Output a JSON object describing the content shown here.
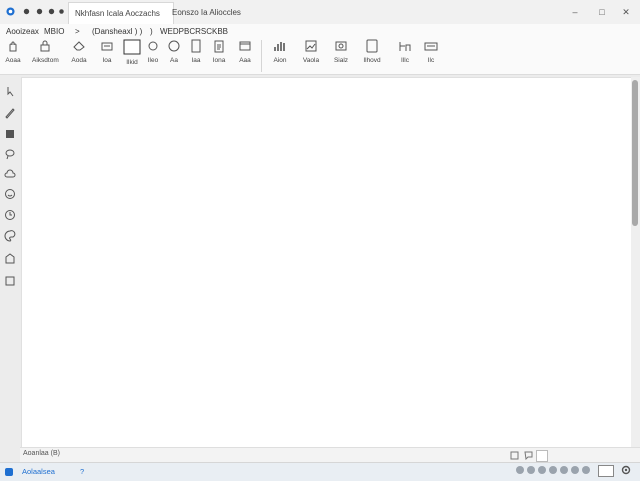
{
  "titlebar": {
    "tabs": [
      "Nkhfasn Icala Aoczachs",
      "Eonszo Ia Alioccles"
    ],
    "controls": {
      "minimize": "–",
      "maximize": "□",
      "close": "✕"
    }
  },
  "ribbon": {
    "breadcrumb": [
      "Aooizeax",
      "MBIO",
      ">",
      "(Dansheaxl ) )",
      ")",
      "WEDPBCRSCKBB"
    ],
    "tools_left": [
      {
        "icon": "hand-icon",
        "label": "Aoaa"
      },
      {
        "icon": "lock-icon",
        "label": "Aiksdtom"
      },
      {
        "icon": "eraser-icon",
        "label": "Aoda"
      },
      {
        "icon": "text-box-icon",
        "label": "Ioa"
      },
      {
        "icon": "rectangle-icon",
        "label": "Ilkid"
      },
      {
        "icon": "circle-icon",
        "label": "Ileo"
      },
      {
        "icon": "circle-outline-icon",
        "label": "Aa"
      },
      {
        "icon": "page-icon",
        "label": "Iaa"
      },
      {
        "icon": "clipboard-icon",
        "label": "Iona"
      },
      {
        "icon": "window-icon",
        "label": "Aaa"
      }
    ],
    "tools_right": [
      {
        "icon": "chart-icon",
        "label": "Aion"
      },
      {
        "icon": "image-icon",
        "label": "Vaola"
      },
      {
        "icon": "media-icon",
        "label": "Sialz"
      },
      {
        "icon": "frame-icon",
        "label": "Ilhovd"
      },
      {
        "icon": "bars-icon",
        "label": "Illc"
      },
      {
        "icon": "keyboard-icon",
        "label": "Ilc"
      }
    ]
  },
  "left_toolbar": [
    "pointer-icon",
    "pen-icon",
    "building-icon",
    "lasso-icon",
    "cloud-icon",
    "smile-icon",
    "clock-icon",
    "palette-icon",
    "shape-icon",
    "square-icon"
  ],
  "bottom_strip": {
    "left_text": "Aoanlaa (B)"
  },
  "statusbar": {
    "left_text": "Aolaalsea",
    "info": "?"
  },
  "colors": {
    "accent": "#1e6fd1",
    "scroll_thumb": "#a9a9a9",
    "canvas": "#ffffff"
  }
}
